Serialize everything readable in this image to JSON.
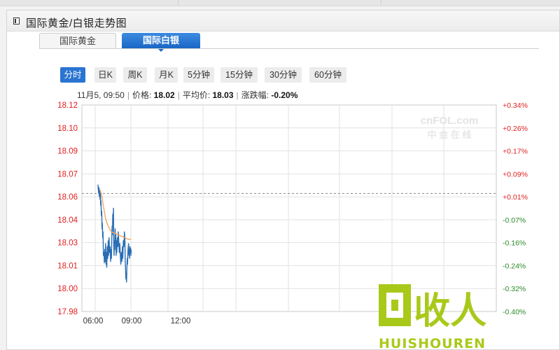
{
  "panel": {
    "title": "国际黄金/白银走势图"
  },
  "tabs": [
    {
      "label": "国际黄金",
      "active": false
    },
    {
      "label": "国际白银",
      "active": true
    }
  ],
  "periods": [
    {
      "label": "分时",
      "active": true
    },
    {
      "label": "日K",
      "active": false
    },
    {
      "label": "周K",
      "active": false
    },
    {
      "label": "月K",
      "active": false
    },
    {
      "label": "5分钟",
      "active": false
    },
    {
      "label": "15分钟",
      "active": false
    },
    {
      "label": "30分钟",
      "active": false
    },
    {
      "label": "60分钟",
      "active": false
    }
  ],
  "info": {
    "time": "11月5, 09:50",
    "price_label": "价格:",
    "price": "18.02",
    "avg_label": "平均价:",
    "avg": "18.03",
    "change_label": "涨跌幅:",
    "change": "-0.20%"
  },
  "watermarks": {
    "cnfol": "cnFOL.com",
    "cnfol_cn": "中 金 在 线",
    "huishouren_cn": "回收人",
    "huishouren_en": "HUISHOUREN"
  },
  "colors": {
    "price_line": "#2a6db5",
    "avg_line": "#f0a560",
    "ref_line": "#888888",
    "positive": "#e02020",
    "negative": "#2a8a2a",
    "tab_active": "#1a66c6"
  },
  "chart_data": {
    "type": "line",
    "x_ticks": [
      "06:00",
      "09:00",
      "12:00"
    ],
    "y_ticks_left": [
      "18.12",
      "18.10",
      "18.09",
      "18.07",
      "18.06",
      "18.04",
      "18.03",
      "18.01",
      "18.00",
      "17.98"
    ],
    "y_ticks_right": [
      "+0.34%",
      "+0.26%",
      "+0.17%",
      "+0.09%",
      "+0.01%",
      "-0.07%",
      "-0.16%",
      "-0.24%",
      "-0.32%",
      "-0.40%"
    ],
    "ylim": [
      17.98,
      18.12
    ],
    "reference_price": 18.06,
    "series": [
      {
        "kind": "price",
        "points": [
          [
            0.0,
            18.066
          ],
          [
            0.02,
            18.062
          ],
          [
            0.04,
            18.06
          ],
          [
            0.06,
            18.064
          ],
          [
            0.08,
            18.058
          ],
          [
            0.1,
            18.062
          ],
          [
            0.12,
            18.056
          ],
          [
            0.14,
            18.06
          ],
          [
            0.16,
            18.052
          ],
          [
            0.18,
            18.055
          ],
          [
            0.2,
            18.045
          ],
          [
            0.22,
            18.048
          ],
          [
            0.24,
            18.036
          ],
          [
            0.26,
            18.04
          ],
          [
            0.28,
            18.03
          ],
          [
            0.3,
            18.034
          ],
          [
            0.32,
            18.018
          ],
          [
            0.35,
            18.02
          ],
          [
            0.38,
            18.013
          ],
          [
            0.4,
            18.022
          ],
          [
            0.42,
            18.014
          ],
          [
            0.45,
            18.026
          ],
          [
            0.48,
            18.012
          ],
          [
            0.5,
            18.02
          ],
          [
            0.52,
            18.01
          ],
          [
            0.55,
            18.024
          ],
          [
            0.58,
            18.016
          ],
          [
            0.61,
            18.028
          ],
          [
            0.63,
            18.018
          ],
          [
            0.66,
            18.03
          ],
          [
            0.69,
            18.02
          ],
          [
            0.72,
            18.024
          ],
          [
            0.75,
            18.014
          ],
          [
            0.78,
            18.022
          ],
          [
            0.8,
            18.016
          ],
          [
            0.82,
            18.03
          ],
          [
            0.84,
            18.038
          ],
          [
            0.86,
            18.032
          ],
          [
            0.88,
            18.046
          ],
          [
            0.9,
            18.04
          ],
          [
            0.92,
            18.05
          ],
          [
            0.94,
            18.024
          ],
          [
            0.96,
            18.018
          ],
          [
            0.98,
            18.028
          ],
          [
            1.0,
            18.022
          ],
          [
            1.02,
            18.036
          ],
          [
            1.04,
            18.028
          ],
          [
            1.06,
            18.032
          ],
          [
            1.08,
            18.018
          ],
          [
            1.1,
            18.028
          ],
          [
            1.12,
            18.02
          ],
          [
            1.15,
            18.03
          ],
          [
            1.18,
            18.024
          ],
          [
            1.21,
            18.034
          ],
          [
            1.24,
            18.026
          ],
          [
            1.27,
            18.02
          ],
          [
            1.3,
            18.026
          ],
          [
            1.33,
            18.018
          ],
          [
            1.36,
            18.012
          ],
          [
            1.39,
            18.02
          ],
          [
            1.42,
            18.014
          ],
          [
            1.45,
            18.024
          ],
          [
            1.48,
            18.016
          ],
          [
            1.51,
            18.028
          ],
          [
            1.54,
            18.024
          ],
          [
            1.57,
            18.034
          ],
          [
            1.6,
            18.03
          ],
          [
            1.62,
            18.014
          ],
          [
            1.64,
            18.008
          ],
          [
            1.66,
            18.002
          ],
          [
            1.68,
            18.006
          ],
          [
            1.7,
            18.0
          ],
          [
            1.72,
            18.01
          ],
          [
            1.74,
            18.016
          ],
          [
            1.76,
            18.012
          ],
          [
            1.78,
            18.02
          ],
          [
            1.8,
            18.024
          ],
          [
            1.82,
            18.026
          ],
          [
            1.84,
            18.018
          ],
          [
            1.86,
            18.022
          ],
          [
            1.88,
            18.016
          ],
          [
            1.9,
            18.024
          ],
          [
            1.92,
            18.02
          ],
          [
            1.94,
            18.023
          ],
          [
            1.96,
            18.018
          ],
          [
            1.98,
            18.022
          ]
        ]
      },
      {
        "kind": "average",
        "points": [
          [
            0.1,
            18.063
          ],
          [
            0.2,
            18.06
          ],
          [
            0.3,
            18.053
          ],
          [
            0.45,
            18.043
          ],
          [
            0.6,
            18.038
          ],
          [
            0.8,
            18.034
          ],
          [
            1.0,
            18.033
          ],
          [
            1.2,
            18.032
          ],
          [
            1.4,
            18.031
          ],
          [
            1.6,
            18.03
          ],
          [
            1.8,
            18.029
          ],
          [
            1.98,
            18.029
          ]
        ]
      }
    ]
  }
}
